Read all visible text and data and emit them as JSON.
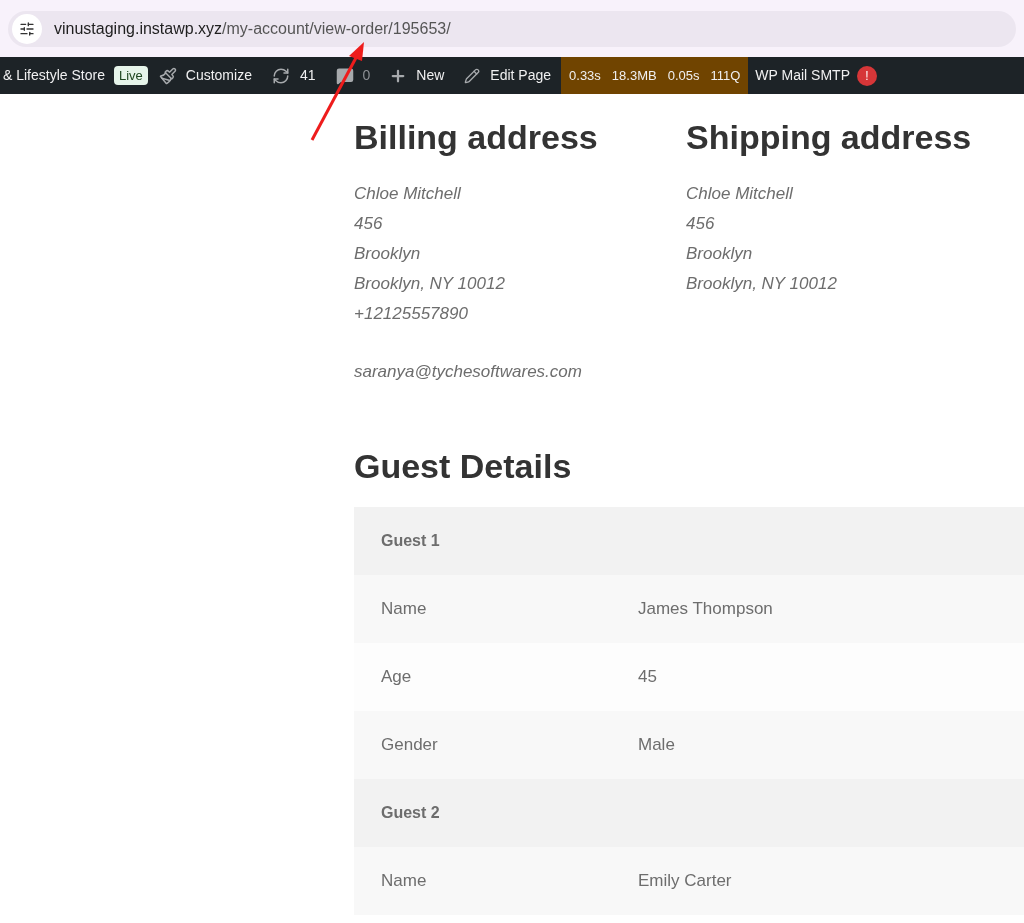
{
  "browser": {
    "url_host": "vinustaging.instawp.xyz",
    "url_path": "/my-account/view-order/195653/"
  },
  "admin_bar": {
    "site": "& Lifestyle Store",
    "status_badge": "Live",
    "customize": "Customize",
    "updates": "41",
    "comments": "0",
    "new": "New",
    "edit": "Edit Page",
    "perf": [
      "0.33s",
      "18.3MB",
      "0.05s",
      "111Q"
    ],
    "mail": "WP Mail SMTP",
    "mail_alert": "!"
  },
  "billing": {
    "title": "Billing address",
    "lines": [
      "Chloe Mitchell",
      "456",
      "Brooklyn",
      "Brooklyn, NY 10012",
      "+12125557890"
    ],
    "email": "saranya@tychesoftwares.com"
  },
  "shipping": {
    "title": "Shipping address",
    "lines": [
      "Chloe Mitchell",
      "456",
      "Brooklyn",
      "Brooklyn, NY 10012"
    ]
  },
  "guest_details": {
    "title": "Guest Details",
    "rows": [
      {
        "kind": "heading",
        "label": "Guest 1"
      },
      {
        "kind": "field",
        "label": "Name",
        "value": "James Thompson"
      },
      {
        "kind": "field",
        "label": "Age",
        "value": "45"
      },
      {
        "kind": "field",
        "label": "Gender",
        "value": "Male"
      },
      {
        "kind": "heading",
        "label": "Guest 2"
      },
      {
        "kind": "field",
        "label": "Name",
        "value": "Emily Carter"
      }
    ]
  }
}
